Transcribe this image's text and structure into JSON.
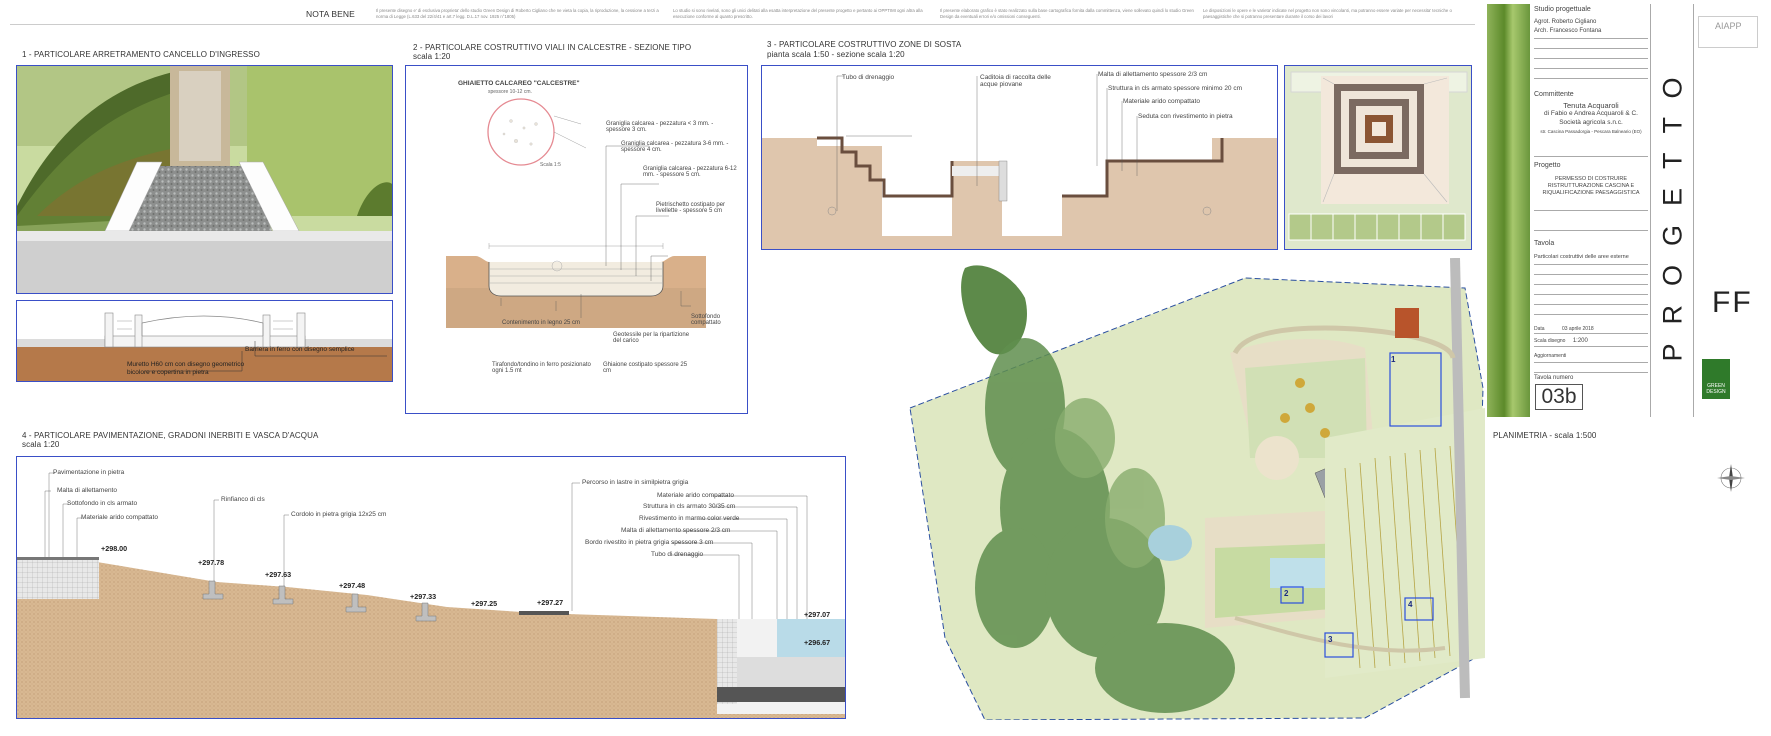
{
  "top_bar": {
    "heading": "NOTA BENE",
    "notes": [
      "Il presente disegno e' di esclusiva proprieta' dello studio Green Design di Roberto Cigliano che ne vieta la copia, la riproduzione, la cessione a terzi a norma di Legge (L.633 del 22/4/41 e art.7 legg. D.L.17 nov. 1925 n°1805)",
      "Lo studio si sono rivelati, sono gli unici delitati alla esatta interpretazione del presente progetto e pertanto ai OPPTIMI ogni altra alla esecuzione conforme al quanto prescritto.",
      "Il presente elaborato grafico è stato realizzato sulla base cartografica fornita dalla committenza, viene sollevato quindi lo studio Green Design da eventuali errori e/o omissioni conseguenti.",
      "Le disposizioni le opere e le varieta' indicate nel progetto non sono vincolanti, ma potranno essere variate per necessita' tecniche o paesaggistiche che si potranno presentare durante il corso dei lavori"
    ]
  },
  "section1": {
    "title": "1 - PARTICOLARE ARRETRAMENTO CANCELLO D'INGRESSO",
    "label_a": "Barriera in ferro con disegno semplice",
    "label_b1": "Muretto H60 cm con disegno geometrico",
    "label_b2": "bicolore e copertina in pietra"
  },
  "section2": {
    "title": "2 - PARTICOLARE COSTRUTTIVO VIALI IN CALCESTRE - SEZIONE TIPO",
    "scale": "scala 1:20",
    "circle_title": "GHIAIETTO CALCAREO \"CALCESTRE\"",
    "circle_sub": "spessore 10-12 cm.",
    "circle_scale": "Scala 1:5",
    "labels": [
      "Graniglia calcarea - pezzatura < 3 mm. - spessore 3 cm.",
      "Graniglia calcarea - pezzatura 3-6 mm. - spessore 4 cm.",
      "Graniglia calcarea - pezzatura 6-12 mm. - spessore 5 cm.",
      "Pietrischetto costipato per livellette - spessore 5 cm",
      "Sottofondo compattato",
      "Contenimento in legno 25 cm",
      "Geotessile per la ripartizione del carico",
      "Tirafondo/tondino in ferro posizionato ogni 1.5 mt",
      "Ghiaione costipato spessore 25 cm"
    ]
  },
  "section3": {
    "title": "3 - PARTICOLARE COSTRUTTIVO ZONE DI SOSTA",
    "scale": "pianta scala 1:50 - sezione scala 1:20",
    "labels": [
      "Tubo di drenaggio",
      "Caditoia di raccolta delle acque piovane",
      "Malta di allettamento spessore 2/3 cm",
      "Struttura in cls armato spessore minimo 20 cm",
      "Materiale arido compattato",
      "Seduta con rivestimento in pietra"
    ]
  },
  "section4": {
    "title": "4 - PARTICOLARE PAVIMENTAZIONE, GRADONI INERBITI E VASCA D'ACQUA",
    "scale": "scala 1:20",
    "labels_left": [
      "Pavimentazione in pietra",
      "Malta di allettamento",
      "Sottofondo in cls armato",
      "Materiale arido compattato"
    ],
    "label_rinfianco": "Rinfianco di cls",
    "label_cordolo": "Cordolo in pietra grigia 12x25 cm",
    "label_percorso": "Percorso in lastre in similpietra grigia",
    "labels_right": [
      "Materiale arido compattato",
      "Struttura in cls armato 30/35 cm",
      "Rivestimento in marmo color verde",
      "Malta di allettamento spessore 2/3 cm",
      "Bordo rivestito in pietra grigia spessore 3 cm",
      "Tubo di drenaggio"
    ],
    "elevations": [
      "+298.00",
      "+297.78",
      "+297.63",
      "+297.48",
      "+297.33",
      "+297.25",
      "+297.27",
      "+297.07",
      "+296.67"
    ]
  },
  "plan": {
    "title": "PLANIMETRIA - scala 1:500",
    "markers": [
      "1",
      "2",
      "3",
      "4"
    ]
  },
  "title_block": {
    "studio_label": "Studio progettuale",
    "studio_names": [
      "Agrot. Roberto Cigliano",
      "Arch. Francesco Fontana"
    ],
    "client_label": "Committente",
    "client_lines": [
      "Tenuta Acquaroli",
      "di Fabio e Andrea Acquaroli & C.",
      "Società agricola s.n.c."
    ],
    "client_address": "str. Cascina Passadorgia - Pescara Balneario (EO)",
    "project_label": "Progetto",
    "project_lines": [
      "PERMESSO DI COSTRUIRE",
      "RISTRUTTURAZIONE CASCINA E",
      "RIQUALIFICAZIONE PAESAGGISTICA"
    ],
    "table_label": "Tavola",
    "table_desc": "Particolari costruttivi delle aree esterne",
    "date_label": "Data",
    "date_value": "03 aprile 2018",
    "scale_label": "Scala disegno",
    "scale_value": "1:200",
    "update_label": "Aggiornamenti",
    "number_label": "Tavola numero",
    "number_value": "03b",
    "vertical_title": "PROGETTO",
    "ff_logo": "FF",
    "aiapp": "AIAPP",
    "green_design": "GREEN DESIGN"
  }
}
